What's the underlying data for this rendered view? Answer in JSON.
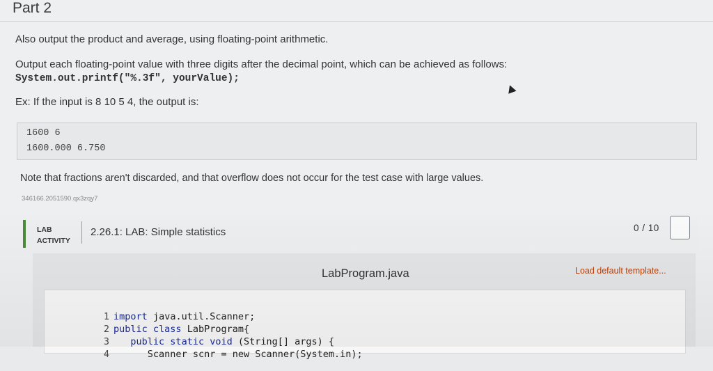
{
  "part": {
    "title": "Part 2"
  },
  "instructions": {
    "line1": "Also output the product and average, using floating-point arithmetic.",
    "line2": "Output each floating-point value with three digits after the decimal point, which can be achieved as follows:",
    "code": "System.out.printf(\"%.3f\", yourValue);",
    "example": "Ex: If the input is 8 10 5 4, the output is:"
  },
  "sample_output": {
    "lines": [
      "1600 6",
      "1600.000 6.750"
    ]
  },
  "note": "Note that fractions aren't discarded, and that overflow does not occur for the test case with large values.",
  "identifier": "346166.2051590.qx3zqy7",
  "lab": {
    "tag_line1": "LAB",
    "tag_line2": "ACTIVITY",
    "title": "2.26.1: LAB: Simple statistics",
    "score": "0 / 10"
  },
  "editor": {
    "filename": "LabProgram.java",
    "load_template": "Load default template...",
    "lines": [
      {
        "num": "1",
        "kw": "import",
        "rest": " java.util.Scanner;"
      },
      {
        "num": "2",
        "kw": "public class",
        "rest": " LabProgram{"
      },
      {
        "num": "3",
        "kw": "   public static void",
        "rest": " (String[] args) {"
      },
      {
        "num": "4",
        "kw": "",
        "rest": "      Scanner scnr = new Scanner(System.in);"
      }
    ]
  },
  "icons": {
    "checkbox": "completion-box-icon",
    "pointer": "mouse-cursor-icon"
  }
}
